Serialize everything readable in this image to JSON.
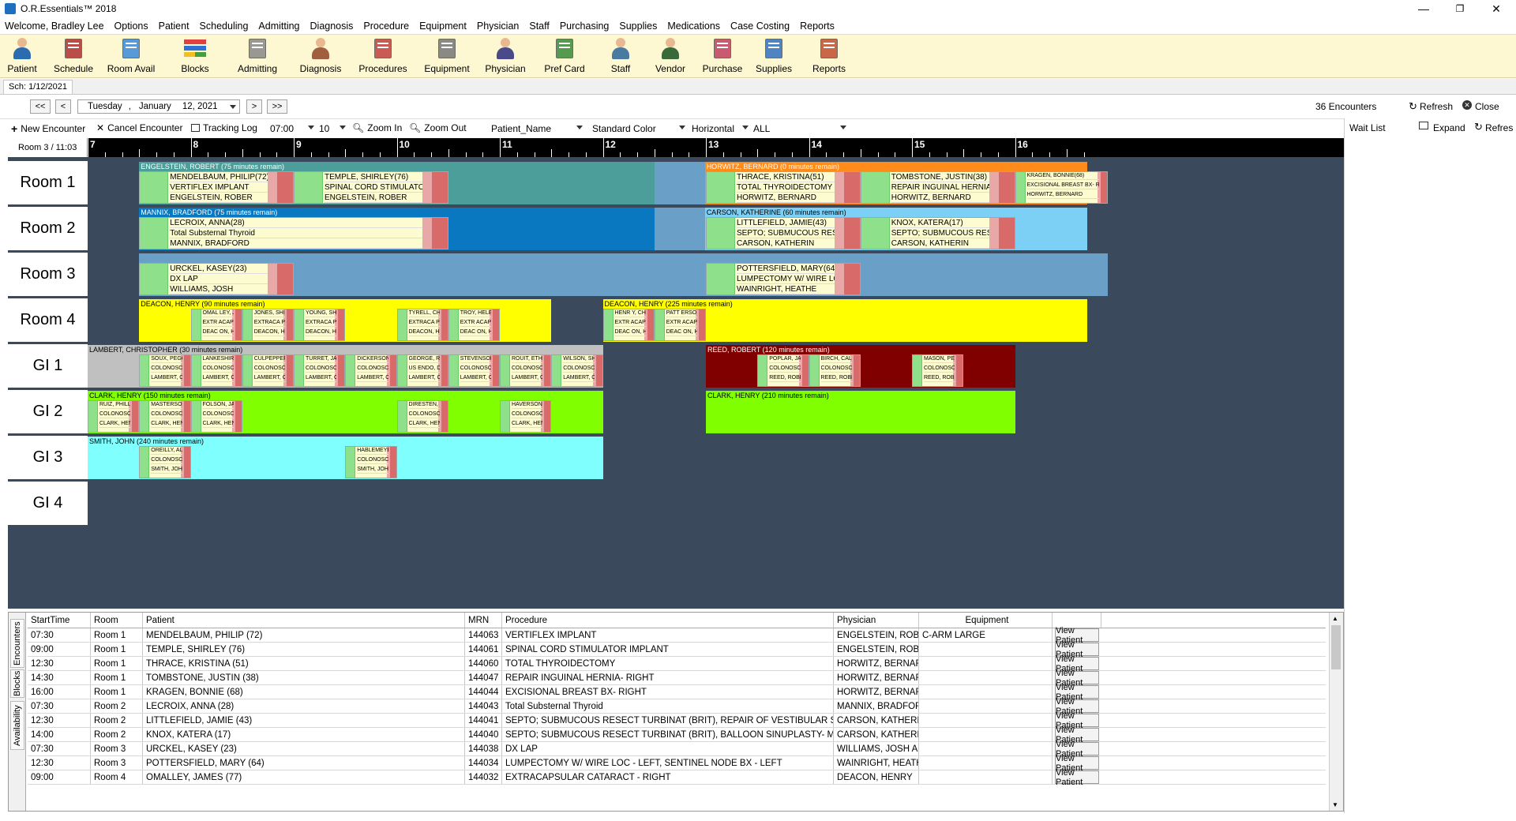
{
  "window": {
    "title": "O.R.Essentials™ 2018",
    "min": "—",
    "max": "❐",
    "close": "✕"
  },
  "menu": [
    "Welcome, Bradley  Lee",
    "Options",
    "Patient",
    "Scheduling",
    "Admitting",
    "Diagnosis",
    "Procedure",
    "Equipment",
    "Physician",
    "Staff",
    "Purchasing",
    "Supplies",
    "Medications",
    "Case Costing",
    "Reports"
  ],
  "toolbar": [
    {
      "label": "Patient",
      "icon": "patient-icon"
    },
    {
      "label": "Schedule",
      "icon": "schedule-book-icon"
    },
    {
      "label": "Room Avail",
      "icon": "room-avail-icon"
    },
    {
      "label": "Blocks",
      "icon": "blocks-icon"
    },
    {
      "label": "Admitting",
      "icon": "admitting-clipboard-icon"
    },
    {
      "label": "Diagnosis",
      "icon": "diagnosis-icon"
    },
    {
      "label": "Procedures",
      "icon": "procedures-icon"
    },
    {
      "label": "Equipment",
      "icon": "equipment-icon"
    },
    {
      "label": "Physician",
      "icon": "physician-icon"
    },
    {
      "label": "Pref Card",
      "icon": "pref-card-icon"
    },
    {
      "label": "Staff",
      "icon": "staff-icon"
    },
    {
      "label": "Vendor",
      "icon": "vendor-icon"
    },
    {
      "label": "Purchase",
      "icon": "purchase-icon"
    },
    {
      "label": "Supplies",
      "icon": "supplies-icon"
    },
    {
      "label": "Reports",
      "icon": "reports-icon"
    }
  ],
  "sched_tab": "Sch: 1/12/2021",
  "nav": {
    "first": "<<",
    "prev": "<",
    "next": ">",
    "last": ">>",
    "date_weekday": "Tuesday",
    "date_sep": ",",
    "date_month": "January",
    "date_day": "12, 2021",
    "encounters": "36 Encounters",
    "refresh": "Refresh",
    "close": "Close"
  },
  "actions": {
    "new_encounter": "New Encounter",
    "cancel_encounter": "Cancel Encounter",
    "tracking_log": "Tracking Log",
    "start_time": "07:00",
    "interval": "10",
    "zoom_in": "Zoom In",
    "zoom_out": "Zoom Out",
    "sort": "Patient_Name",
    "color": "Standard Color",
    "orientation": "Horizontal",
    "filter": "ALL"
  },
  "right_panel": {
    "title": "Wait List",
    "expand": "Expand",
    "refresh": "Refres"
  },
  "scheduler": {
    "corner": "Room 3 / 11:03",
    "hours": [
      "7",
      "8",
      "9",
      "10",
      "11",
      "12",
      "13",
      "14",
      "15",
      "16"
    ],
    "rooms": [
      "Room 1",
      "Room 2",
      "Room 3",
      "Room 4",
      "GI 1",
      "GI 2",
      "GI 3",
      "GI 4"
    ],
    "blocks": [
      {
        "row": 0,
        "start": 7.5,
        "end": 12.75,
        "color": "#4c9e9a",
        "label": "ENGELSTEIN, ROBERT (75 minutes remain)"
      },
      {
        "row": 0,
        "start": 12.5,
        "end": 12.99,
        "color": "#6aa0c8",
        "label": ""
      },
      {
        "row": 0,
        "start": 12.99,
        "end": 16.7,
        "color": "#ff8c1a",
        "label": "HORWITZ, BERNARD (0 minutes remain)"
      },
      {
        "row": 1,
        "start": 7.5,
        "end": 12.5,
        "color": "#0a78c0",
        "label": "MANNIX, BRADFORD (75 minutes remain)"
      },
      {
        "row": 1,
        "start": 12.5,
        "end": 12.99,
        "color": "#6aa0c8",
        "label": ""
      },
      {
        "row": 1,
        "start": 12.99,
        "end": 16.7,
        "color": "#7ccff5",
        "label": "CARSON, KATHERINE (60 minutes remain)"
      },
      {
        "row": 2,
        "start": 7.5,
        "end": 16.9,
        "color": "#6aa0c8",
        "label": ""
      },
      {
        "row": 3,
        "start": 7.5,
        "end": 11.5,
        "color": "#ffff00",
        "label": "DEACON, HENRY (90 minutes remain)"
      },
      {
        "row": 3,
        "start": 12.0,
        "end": 16.7,
        "color": "#ffff00",
        "label": "DEACON, HENRY (225 minutes remain)"
      },
      {
        "row": 4,
        "start": 7.0,
        "end": 12.0,
        "color": "#c0c0c0",
        "label": "LAMBERT, CHRISTOPHER (30 minutes remain)"
      },
      {
        "row": 4,
        "start": 13.0,
        "end": 16.0,
        "color": "#800000",
        "label": "REED, ROBERT (120 minutes remain)"
      },
      {
        "row": 5,
        "start": 7.0,
        "end": 12.0,
        "color": "#80ff00",
        "label": "CLARK, HENRY (150 minutes remain)"
      },
      {
        "row": 5,
        "start": 13.0,
        "end": 16.0,
        "color": "#80ff00",
        "label": "CLARK, HENRY (210 minutes remain)"
      },
      {
        "row": 6,
        "start": 7.0,
        "end": 12.0,
        "color": "#80ffff",
        "label": "SMITH, JOHN (240 minutes remain)"
      }
    ],
    "encounters": [
      {
        "row": 0,
        "start": 7.5,
        "end": 9.0,
        "lines": [
          "MENDELBAUM, PHILIP(72)",
          "VERTIFLEX IMPLANT",
          "ENGELSTEIN, ROBER"
        ]
      },
      {
        "row": 0,
        "start": 9.0,
        "end": 10.5,
        "lines": [
          "TEMPLE, SHIRLEY(76)",
          "SPINAL CORD STIMULATOR IMPLANT",
          "ENGELSTEIN, ROBER"
        ]
      },
      {
        "row": 0,
        "start": 13.0,
        "end": 14.5,
        "lines": [
          "THRACE, KRISTINA(51)",
          "TOTAL THYROIDECTOMY",
          "HORWITZ, BERNARD"
        ]
      },
      {
        "row": 0,
        "start": 14.5,
        "end": 16.0,
        "lines": [
          "TOMBSTONE, JUSTIN(38)",
          "REPAIR INGUINAL HERNIA- RIGHT",
          "HORWITZ, BERNARD"
        ]
      },
      {
        "row": 0,
        "start": 16.0,
        "end": 16.9,
        "lines": [
          "KRAGEN, BONNIE(68)",
          "EXCISIONAL BREAST BX- RI",
          "HORWITZ, BERNARD"
        ],
        "small": true
      },
      {
        "row": 1,
        "start": 7.5,
        "end": 10.5,
        "lines": [
          "LECROIX, ANNA(28)",
          "Total Substernal Thyroid",
          "MANNIX, BRADFORD"
        ]
      },
      {
        "row": 1,
        "start": 13.0,
        "end": 14.5,
        "lines": [
          "LITTLEFIELD, JAMIE(43)",
          "SEPTO; SUBMUCOUS RESECT TURBINAT (BRIT), REPAIR OF VE",
          "CARSON, KATHERIN"
        ]
      },
      {
        "row": 1,
        "start": 14.5,
        "end": 16.0,
        "lines": [
          "KNOX, KATERA(17)",
          "SEPTO; SUBMUCOUS RESECT TURBINAT (BRIT), BALLOON SINUPLAST",
          "CARSON, KATHERIN"
        ]
      },
      {
        "row": 2,
        "start": 7.5,
        "end": 9.0,
        "lines": [
          "URCKEL, KASEY(23)",
          "DX LAP",
          "WILLIAMS, JOSH"
        ]
      },
      {
        "row": 2,
        "start": 13.0,
        "end": 14.5,
        "lines": [
          "POTTERSFIELD, MARY(64)",
          "LUMPECTOMY W/ WIRE LOC - LEFT; SENTINEL NODE BX - LEFT",
          "WAINRIGHT, HEATHE"
        ]
      },
      {
        "row": 3,
        "start": 8.0,
        "end": 8.5,
        "lines": [
          "OMAL LEY, J",
          "EXTR ACAP",
          "DEAC ON, H"
        ],
        "small": true
      },
      {
        "row": 3,
        "start": 8.5,
        "end": 9.0,
        "lines": [
          "JONES, SHIRLEY(",
          "EXTRACA PSULAR C",
          "DEACON, HENR"
        ],
        "small": true
      },
      {
        "row": 3,
        "start": 9.0,
        "end": 9.5,
        "lines": [
          "YOUNG, SHERRE(",
          "EXTRACA PSULAR C",
          "DEACON, HENR"
        ],
        "small": true
      },
      {
        "row": 3,
        "start": 10.0,
        "end": 10.5,
        "lines": [
          "TYRELL, CHERYL(7",
          "EXTRACA PSULAR C",
          "DEACON, HENR"
        ],
        "small": true
      },
      {
        "row": 3,
        "start": 10.5,
        "end": 11.0,
        "lines": [
          "TROY, HELE",
          "EXTR ACAP",
          "DEAC ON, H"
        ],
        "small": true
      },
      {
        "row": 3,
        "start": 12.0,
        "end": 12.5,
        "lines": [
          "HENR Y, CH",
          "EXTR ACAP",
          "DEAC ON, H"
        ],
        "small": true
      },
      {
        "row": 3,
        "start": 12.5,
        "end": 13.0,
        "lines": [
          "PATT ERSO",
          "EXTR ACAP",
          "DEAC ON, H"
        ],
        "small": true
      },
      {
        "row": 4,
        "start": 7.5,
        "end": 8.0,
        "lines": [
          "SOUX, PEGGY(64)",
          "COLONOSCO PY HIGH RISK",
          "LAMBERT, CHRISTOPHE"
        ],
        "small": true
      },
      {
        "row": 4,
        "start": 8.0,
        "end": 8.5,
        "lines": [
          "LANKESHIRE, LEOS(1",
          "COLONOSCO PY HIGH RISK",
          "LAMBERT, CHRISTOPHE"
        ],
        "small": true
      },
      {
        "row": 4,
        "start": 8.5,
        "end": 9.0,
        "lines": [
          "CULPEPPER, ROBERT(67)",
          "COLONOSCO PY FLEX PRO",
          "LAMBERT, CHRISTOPHE"
        ],
        "small": true
      },
      {
        "row": 4,
        "start": 9.0,
        "end": 9.5,
        "lines": [
          "TURRET, JAMES(77)",
          "COLONOSCO PY FLEX PRO",
          "LAMBERT, CHRISTOPHE"
        ],
        "small": true
      },
      {
        "row": 4,
        "start": 9.5,
        "end": 10.0,
        "lines": [
          "DICKERSON, DAVID(85)",
          "COLONOSCO PY HIGH RISK",
          "LAMBERT, CHRISTOPHE"
        ],
        "small": true
      },
      {
        "row": 4,
        "start": 10.0,
        "end": 10.5,
        "lines": [
          "GEORGE, RICHARD(60",
          "US ENDO, DX W/WO COLLE",
          "LAMBERT, CHRISTOPHE"
        ],
        "small": true
      },
      {
        "row": 4,
        "start": 10.5,
        "end": 11.0,
        "lines": [
          "STEVENSON, STEPHEN(22",
          "COLONOSCO PY FLEX PRO",
          "LAMBERT, CHRISTOPHE"
        ],
        "small": true
      },
      {
        "row": 4,
        "start": 11.0,
        "end": 11.5,
        "lines": [
          "ROUIT, ETHAN(37)",
          "COLONOSCO PY HIGH RISK",
          "LAMBERT, CHRISTOPHE"
        ],
        "small": true
      },
      {
        "row": 4,
        "start": 11.5,
        "end": 12.0,
        "lines": [
          "WILSON, SHANNON(53)",
          "COLONOSCO PY HIGH RISK",
          "LAMBERT, CHRISTOPHE"
        ],
        "small": true
      },
      {
        "row": 4,
        "start": 13.5,
        "end": 14.0,
        "lines": [
          "POPLAR, JAMES(64)",
          "COLONOSCO PY FLEX PRO",
          "REED, ROBERT"
        ],
        "small": true
      },
      {
        "row": 4,
        "start": 14.0,
        "end": 14.5,
        "lines": [
          "BIRCH, CALLIE(21)",
          "COLONOSCO PY HIGH RISK",
          "REED, ROBERT"
        ],
        "small": true
      },
      {
        "row": 4,
        "start": 15.0,
        "end": 15.5,
        "lines": [
          "MASON, PERRY(53)",
          "COLONOSCO PY FLEX PRO",
          "REED, ROBERT"
        ],
        "small": true
      },
      {
        "row": 5,
        "start": 7.0,
        "end": 7.5,
        "lines": [
          "RUIZ, PHILLIP (72)",
          "COLONOSCO PY HIGH RISK",
          "CLARK, HENRY"
        ],
        "small": true
      },
      {
        "row": 5,
        "start": 7.5,
        "end": 8.0,
        "lines": [
          "MASTERSON, WILLIAMS(",
          "COLONOSCO PY HIGH RISK",
          "CLARK, HENRY"
        ],
        "small": true
      },
      {
        "row": 5,
        "start": 8.0,
        "end": 8.5,
        "lines": [
          "FOLSON, JAMES(34)",
          "COLONOSCO PY FLEX PRO",
          "CLARK, HENRY"
        ],
        "small": true
      },
      {
        "row": 5,
        "start": 10.0,
        "end": 10.5,
        "lines": [
          "DIRESTEN, JUDY(77)",
          "COLONOSCO PY FLEX PRO",
          "CLARK, HENRY"
        ],
        "small": true
      },
      {
        "row": 5,
        "start": 11.0,
        "end": 11.5,
        "lines": [
          "HAVERSON, LINDA(70)",
          "COLONOSCO PY FLEX PRO",
          "CLARK, HENRY"
        ],
        "small": true
      },
      {
        "row": 6,
        "start": 7.5,
        "end": 8.0,
        "lines": [
          "OREILLY, ALYSSA(48",
          "COLONOSCO PY FLEX PRO",
          "SMITH, JOH"
        ],
        "small": true
      },
      {
        "row": 6,
        "start": 9.5,
        "end": 10.0,
        "lines": [
          "HABLEMEYER, CHELSIE(25)",
          "COLONOSCO PY FLEX PRO",
          "SMITH, JOH"
        ],
        "small": true
      }
    ]
  },
  "grid": {
    "side_tabs": [
      "Encounters",
      "Blocks",
      "Availability"
    ],
    "columns": [
      "StartTime",
      "Room",
      "Patient",
      "MRN",
      "Procedure",
      "Physician",
      "Equipment",
      ""
    ],
    "view_label": "View Patient",
    "rows": [
      [
        "07:30",
        "Room 1",
        "MENDELBAUM, PHILIP (72)",
        "144063",
        "VERTIFLEX IMPLANT",
        "ENGELSTEIN, ROBERT",
        "C-ARM LARGE"
      ],
      [
        "09:00",
        "Room 1",
        "TEMPLE, SHIRLEY (76)",
        "144061",
        "SPINAL CORD STIMULATOR IMPLANT",
        "ENGELSTEIN, ROBERT",
        ""
      ],
      [
        "12:30",
        "Room 1",
        "THRACE, KRISTINA (51)",
        "144060",
        "TOTAL THYROIDECTOMY",
        "HORWITZ, BERNARD B",
        ""
      ],
      [
        "14:30",
        "Room 1",
        "TOMBSTONE, JUSTIN (38)",
        "144047",
        "REPAIR INGUINAL HERNIA- RIGHT",
        "HORWITZ, BERNARD B",
        ""
      ],
      [
        "16:00",
        "Room 1",
        "KRAGEN, BONNIE (68)",
        "144044",
        "EXCISIONAL  BREAST BX- RIGHT",
        "HORWITZ, BERNARD B",
        ""
      ],
      [
        "07:30",
        "Room 2",
        "LECROIX, ANNA (28)",
        "144043",
        "Total Substernal Thyroid",
        "MANNIX, BRADFORD D",
        ""
      ],
      [
        "12:30",
        "Room 2",
        "LITTLEFIELD, JAMIE (43)",
        "144041",
        "SEPTO; SUBMUCOUS RESECT TURBINAT (BRIT), REPAIR OF VESTIBULAR STENOSIS",
        "CARSON, KATHERINE",
        ""
      ],
      [
        "14:00",
        "Room 2",
        "KNOX, KATERA (17)",
        "144040",
        "SEPTO; SUBMUCOUS RESECT TURBINAT (BRIT), BALLOON SINUPLASTY- MAXILLARY- BILATERA...",
        "CARSON, KATHERINE",
        ""
      ],
      [
        "07:30",
        "Room 3",
        "URCKEL, KASEY (23)",
        "144038",
        "DX LAP",
        "WILLIAMS, JOSH A",
        ""
      ],
      [
        "12:30",
        "Room 3",
        "POTTERSFIELD, MARY (64)",
        "144034",
        "LUMPECTOMY W/ WIRE LOC - LEFT, SENTINEL NODE BX - LEFT",
        "WAINRIGHT, HEATHER",
        ""
      ],
      [
        "09:00",
        "Room 4",
        "OMALLEY, JAMES (77)",
        "144032",
        "EXTRACAPSULAR CATARACT - RIGHT",
        "DEACON, HENRY",
        ""
      ]
    ]
  }
}
